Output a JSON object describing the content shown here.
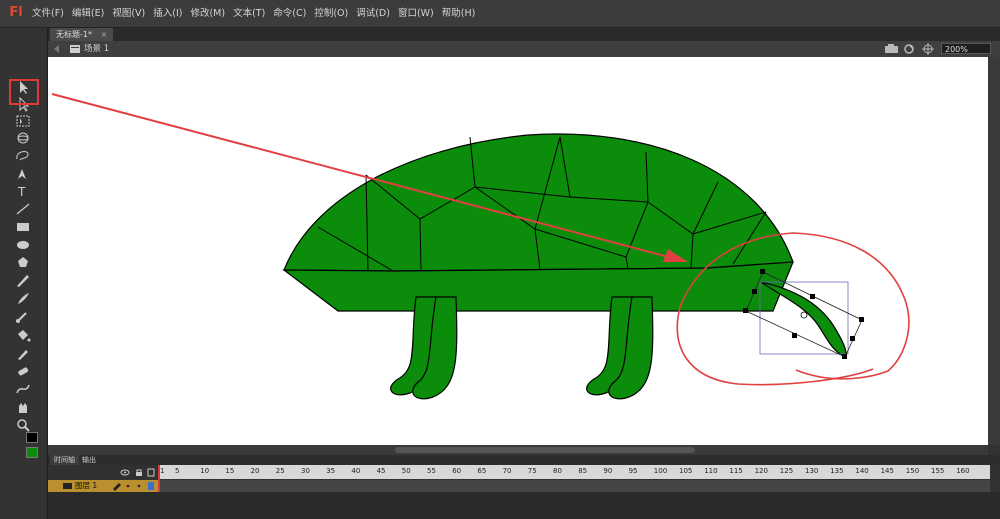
{
  "app": {
    "logo": "Fl"
  },
  "menu": [
    "文件(F)",
    "编辑(E)",
    "视图(V)",
    "插入(I)",
    "修改(M)",
    "文本(T)",
    "命令(C)",
    "控制(O)",
    "调试(D)",
    "窗口(W)",
    "帮助(H)"
  ],
  "document": {
    "tab_title": "无标题-1*",
    "close_glyph": "×"
  },
  "scene": {
    "label": "场景 1"
  },
  "zoom": {
    "value": "200%"
  },
  "colors": {
    "stroke": "#000000",
    "fill": "#0b8c0b",
    "annotation": "#e04040"
  },
  "tools": [
    "selection-tool",
    "subselection-tool",
    "free-transform-tool",
    "3d-rotation-tool",
    "lasso-tool",
    "pen-tool",
    "text-tool",
    "line-tool",
    "rectangle-tool",
    "oval-tool",
    "polystar-tool",
    "pencil-tool",
    "brush-tool",
    "bone-tool",
    "paint-bucket-tool",
    "eyedropper-tool",
    "eraser-tool",
    "width-tool",
    "hand-tool",
    "zoom-tool"
  ],
  "timeline": {
    "tabs": [
      "时间轴",
      "输出"
    ],
    "layer_name": "图层 1",
    "frame_labels": [
      "1",
      "5",
      "10",
      "15",
      "20",
      "25",
      "30",
      "35",
      "40",
      "45",
      "50",
      "55",
      "60",
      "65",
      "70",
      "75",
      "80",
      "85",
      "90",
      "95",
      "100",
      "105",
      "110",
      "115",
      "120",
      "125",
      "130",
      "135",
      "140",
      "145",
      "150",
      "155",
      "160"
    ]
  }
}
